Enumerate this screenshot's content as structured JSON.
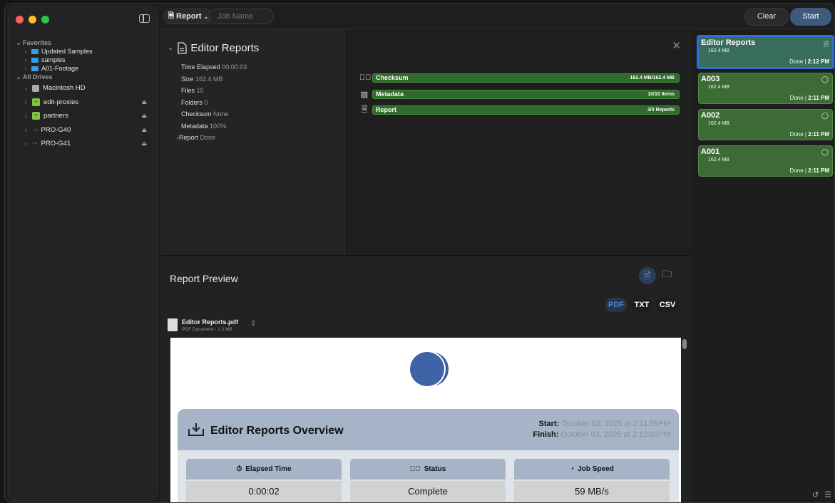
{
  "sidebar": {
    "favorites_label": "Favorites",
    "favorites": [
      "Updated Samples",
      "samples",
      "A01-Footage"
    ],
    "all_drives_label": "All Drives",
    "drives": [
      "Macintosh HD",
      "edit-proxies",
      "partners",
      "PRO-G40",
      "PRO-G41"
    ]
  },
  "toolbar": {
    "report_label": "Report",
    "job_name_placeholder": "Job Name",
    "clear_label": "Clear",
    "start_label": "Start"
  },
  "summary": {
    "title": "Editor Reports",
    "rows": [
      {
        "k": "Time Elapsed",
        "v": "00:00:03"
      },
      {
        "k": "Size",
        "v": "162.4 MB"
      },
      {
        "k": "Files",
        "v": "10"
      },
      {
        "k": "Folders",
        "v": "0"
      },
      {
        "k": "Checksum",
        "v": "None"
      },
      {
        "k": "Metadata",
        "v": "100%"
      },
      {
        "k": "Report",
        "v": "Done"
      }
    ]
  },
  "progress": {
    "rows": [
      {
        "label": "Checksum",
        "right": "162.4 MB/162.4 MB",
        "icon": "checkmark-circle-icon"
      },
      {
        "label": "Metadata",
        "right": "10/10 Items",
        "icon": "image-icon"
      },
      {
        "label": "Report",
        "right": "3/3 Reports",
        "icon": "document-icon"
      }
    ]
  },
  "preview": {
    "title": "Report Preview",
    "formats": [
      "PDF",
      "TXT",
      "CSV"
    ],
    "file_name": "Editor Reports.pdf",
    "file_meta": "PDF Document - 1.2 MB",
    "overview_title": "Editor Reports Overview",
    "start_label": "Start:",
    "start_value": "October 03, 2025 at 2:11:59PM",
    "finish_label": "Finish:",
    "finish_value": "October 03, 2025 at 2:12:02PM",
    "stats": [
      {
        "label": "Elapsed Time",
        "value": "0:00:02",
        "icon": "stopwatch-icon"
      },
      {
        "label": "Status",
        "value": "Complete",
        "icon": "checkmark-circle-icon"
      },
      {
        "label": "Job Speed",
        "value": "59 MB/s",
        "icon": "speedometer-icon"
      }
    ]
  },
  "queue": [
    {
      "name": "Editor Reports",
      "size": "162.4 MB",
      "status": "Done",
      "time": "2:12 PM",
      "selected": true
    },
    {
      "name": "A003",
      "size": "162.4 MB",
      "status": "Done",
      "time": "2:11 PM"
    },
    {
      "name": "A002",
      "size": "162.4 MB",
      "status": "Done",
      "time": "2:11 PM"
    },
    {
      "name": "A001",
      "size": "162.4 MB",
      "status": "Done",
      "time": "2:11 PM"
    }
  ],
  "colors": {
    "accent": "#2d6fd6",
    "progress_green": "#2f6b2a",
    "card_green": "#3d6b35"
  }
}
